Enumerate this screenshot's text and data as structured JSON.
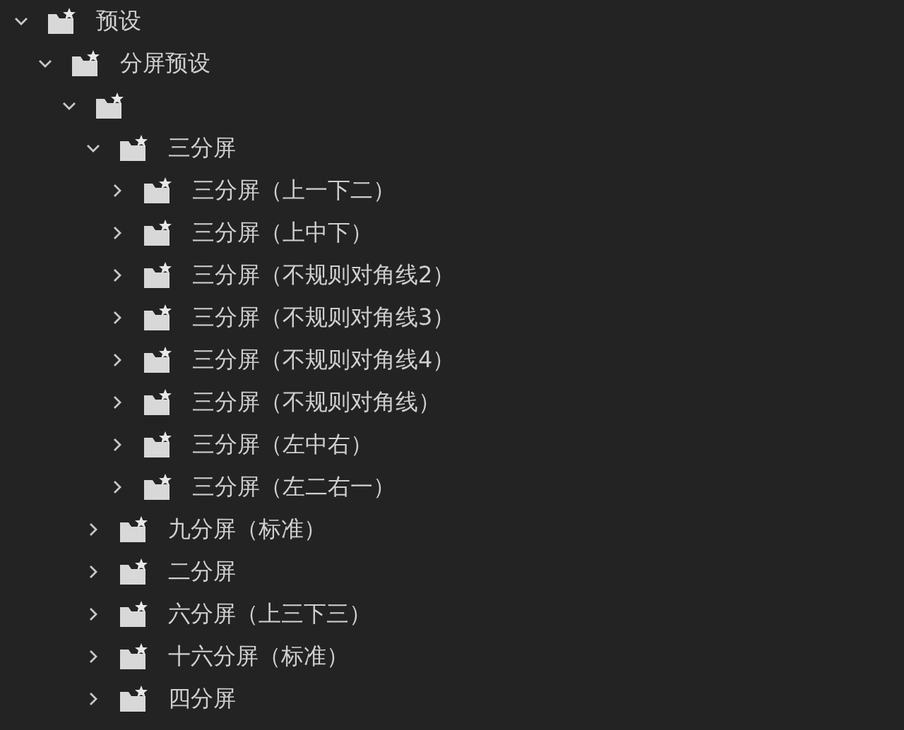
{
  "tree": [
    {
      "label": "预设",
      "expanded": true,
      "children": [
        {
          "label": "分屏预设",
          "expanded": true,
          "children": [
            {
              "expanded": true,
              "children": [
                {
                  "label": "三分屏",
                  "expanded": true,
                  "children": [
                    {
                      "label": "三分屏（上一下二）",
                      "expanded": false
                    },
                    {
                      "label": "三分屏（上中下）",
                      "expanded": false
                    },
                    {
                      "label": "三分屏（不规则对角线2）",
                      "expanded": false
                    },
                    {
                      "label": "三分屏（不规则对角线3）",
                      "expanded": false
                    },
                    {
                      "label": "三分屏（不规则对角线4）",
                      "expanded": false
                    },
                    {
                      "label": "三分屏（不规则对角线）",
                      "expanded": false
                    },
                    {
                      "label": "三分屏（左中右）",
                      "expanded": false
                    },
                    {
                      "label": "三分屏（左二右一）",
                      "expanded": false
                    }
                  ]
                },
                {
                  "label": "九分屏（标准）",
                  "expanded": false
                },
                {
                  "label": "二分屏",
                  "expanded": false
                },
                {
                  "label": "六分屏（上三下三）",
                  "expanded": false
                },
                {
                  "label": "十六分屏（标准）",
                  "expanded": false
                },
                {
                  "label": "四分屏",
                  "expanded": false
                }
              ]
            }
          ]
        }
      ]
    }
  ]
}
